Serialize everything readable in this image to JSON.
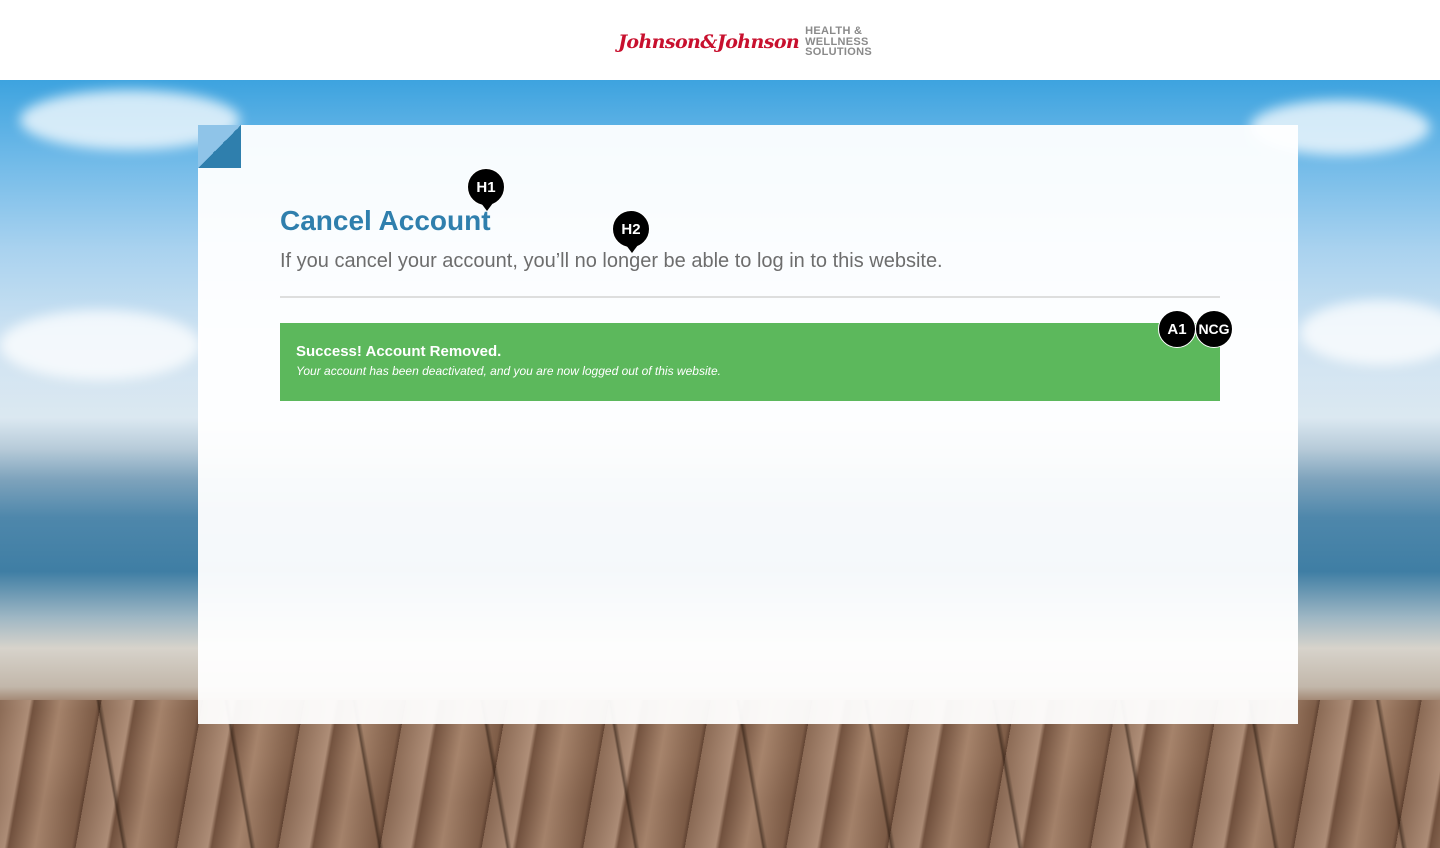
{
  "header": {
    "brand_script": "Johnson&Johnson",
    "brand_lines": [
      "HEALTH &",
      "WELLNESS",
      "SOLUTIONS"
    ]
  },
  "page": {
    "title": "Cancel Account",
    "subtitle": "If you cancel your account, you’ll no longer be able to log in to this website."
  },
  "alert": {
    "title": "Success! Account Removed.",
    "body": "Your account has been deactivated, and you are now logged out of this website.",
    "color": "#5cb85c"
  },
  "badges": {
    "h1": "H1",
    "h2": "H2",
    "a1": "A1",
    "ncg": "NCG"
  },
  "colors": {
    "accent": "#2f7fad",
    "brand_red": "#c8102e"
  }
}
